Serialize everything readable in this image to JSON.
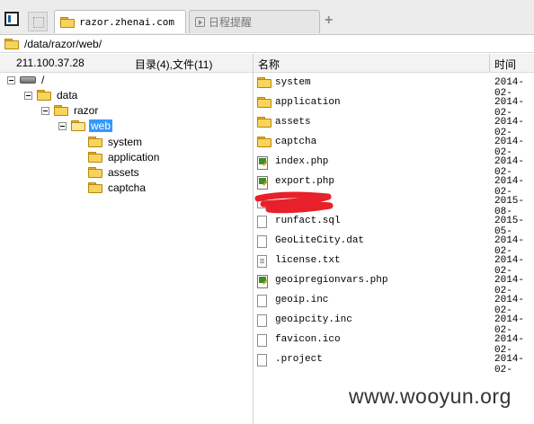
{
  "tabs": [
    {
      "label": "razor.zhenai.com",
      "active": true
    },
    {
      "label": "日程提醒",
      "active": false
    }
  ],
  "new_tab_symbol": "+",
  "address": {
    "path": "/data/razor/web/"
  },
  "left_panel": {
    "ip": "211.100.37.28",
    "count": "目录(4),文件(11)"
  },
  "tree": {
    "root": "/",
    "data": "data",
    "razor": "razor",
    "web": "web",
    "children": [
      "system",
      "application",
      "assets",
      "captcha"
    ]
  },
  "file_list": {
    "headers": {
      "name": "名称",
      "time": "时间"
    },
    "rows": [
      {
        "name": "system",
        "time": "2014-02-",
        "icon": "folder-icon"
      },
      {
        "name": "application",
        "time": "2014-02-",
        "icon": "folder-icon"
      },
      {
        "name": "assets",
        "time": "2014-02-",
        "icon": "folder-icon"
      },
      {
        "name": "captcha",
        "time": "2014-02-",
        "icon": "folder-icon"
      },
      {
        "name": "index.php",
        "time": "2014-02-",
        "icon": "php-file-icon"
      },
      {
        "name": "export.php",
        "time": "2014-02-",
        "icon": "php-file-icon"
      },
      {
        "name": "",
        "time": "2015-08-",
        "icon": "file-icon"
      },
      {
        "name": "runfact.sql",
        "time": "2015-05-",
        "icon": "file-icon"
      },
      {
        "name": "GeoLiteCity.dat",
        "time": "2014-02-",
        "icon": "file-icon"
      },
      {
        "name": "license.txt",
        "time": "2014-02-",
        "icon": "text-file-icon"
      },
      {
        "name": "geoipregionvars.php",
        "time": "2014-02-",
        "icon": "php-file-icon"
      },
      {
        "name": "geoip.inc",
        "time": "2014-02-",
        "icon": "file-icon"
      },
      {
        "name": "geoipcity.inc",
        "time": "2014-02-",
        "icon": "file-icon"
      },
      {
        "name": "favicon.ico",
        "time": "2014-02-",
        "icon": "file-icon"
      },
      {
        "name": ".project",
        "time": "2014-02-",
        "icon": "file-icon"
      }
    ]
  },
  "watermark": "www.wooyun.org",
  "colors": {
    "selection": "#3399ff",
    "redaction": "#e8202a",
    "folder": "#f7d45c"
  }
}
